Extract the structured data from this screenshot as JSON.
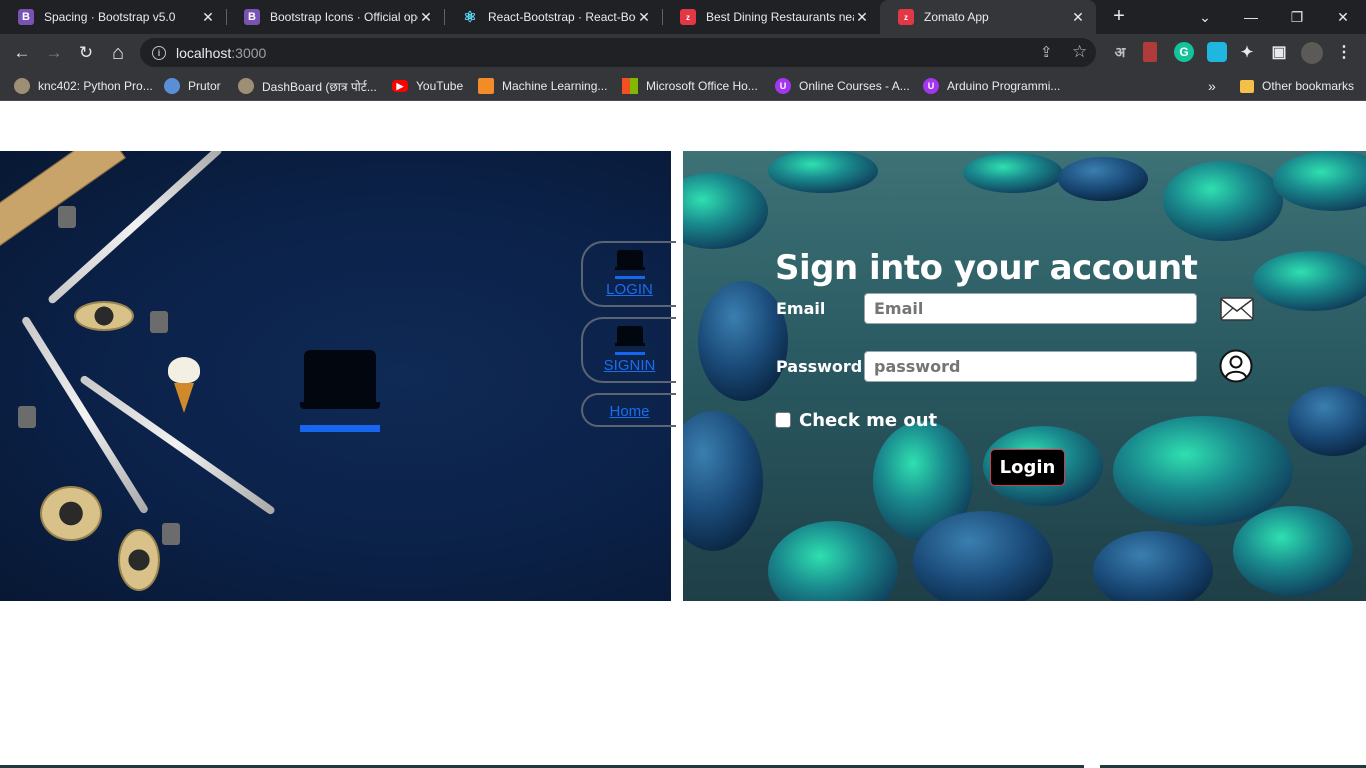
{
  "browser": {
    "tabs": [
      {
        "title": "Spacing · Bootstrap v5.0",
        "favicon_letter": "B",
        "favicon_color": "#7952b3",
        "active": false
      },
      {
        "title": "Bootstrap Icons · Official ope",
        "favicon_letter": "B",
        "favicon_color": "#7952b3",
        "active": false
      },
      {
        "title": "React-Bootstrap · React-Boot",
        "favicon_letter": "⚛",
        "favicon_color": "#61dafb",
        "active": false
      },
      {
        "title": "Best Dining Restaurants near",
        "favicon_letter": "z",
        "favicon_color": "#e23744",
        "active": false
      },
      {
        "title": "Zomato App",
        "favicon_letter": "z",
        "favicon_color": "#e23744",
        "active": true
      }
    ],
    "tab_close_glyph": "✕",
    "new_tab_glyph": "+",
    "window_controls": {
      "menu": "⌄",
      "minimize": "—",
      "restore": "❐",
      "close": "✕"
    },
    "url_host": "localhost",
    "url_port": ":3000",
    "address_info": "i",
    "toolbar_icons": {
      "back": "←",
      "forward": "→",
      "reload": "↻",
      "home": "⌂",
      "share": "⇪",
      "star": "☆",
      "translate": "अ",
      "extensions": "✦",
      "sidebar": "▣",
      "menu": "⋮"
    },
    "bookmarks": [
      {
        "label": "knc402: Python Pro...",
        "icon_color": "#9e8e73"
      },
      {
        "label": "Prutor",
        "icon_color": "#5a8fd8"
      },
      {
        "label": "DashBoard (छात्र पोर्ट...",
        "icon_color": "#9e8e73"
      },
      {
        "label": "YouTube",
        "icon_color": "#ff0000"
      },
      {
        "label": "Machine Learning...",
        "icon_color": "#f28c28"
      },
      {
        "label": "Microsoft Office Ho...",
        "icon_color": "#f25022"
      },
      {
        "label": "Online Courses - A...",
        "icon_color": "#a435f0"
      },
      {
        "label": "Arduino Programmi...",
        "icon_color": "#a435f0"
      }
    ],
    "bookmarks_overflow": "»",
    "other_bookmarks": "Other bookmarks"
  },
  "nav": {
    "login": "LOGIN",
    "signin": "SIGNIN",
    "home": "Home"
  },
  "form": {
    "title": "Sign into your account",
    "email_label": "Email",
    "email_placeholder": "Email",
    "password_label": "Password",
    "password_placeholder": "password",
    "check_label": "Check me out",
    "login_button": "Login"
  },
  "colors": {
    "accent_blue": "#1766f0",
    "login_border": "#d9344a"
  }
}
